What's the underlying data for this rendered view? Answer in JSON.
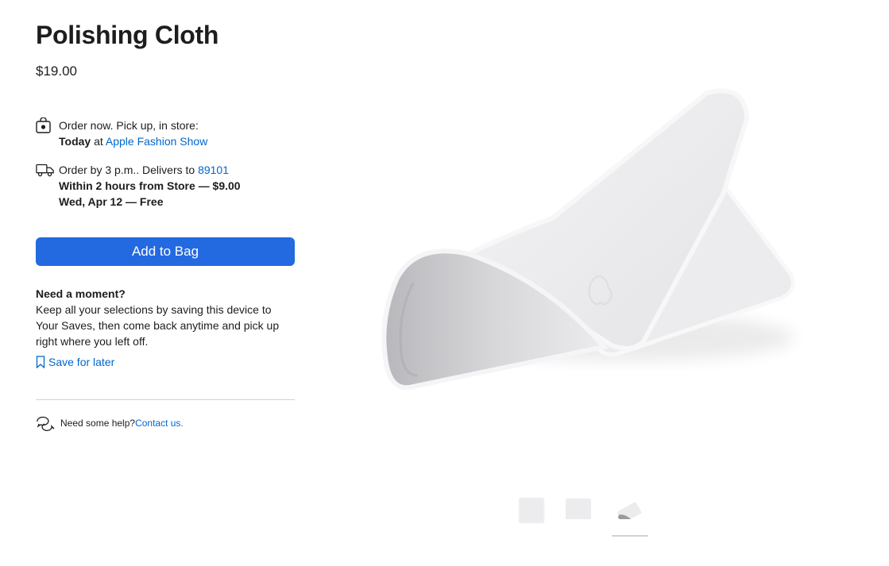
{
  "product": {
    "title": "Polishing Cloth",
    "price": "$19.00"
  },
  "pickup": {
    "icon": "shopping-bag-icon",
    "line1": "Order now. Pick up, in store:",
    "when": "Today",
    "at": " at ",
    "store": "Apple Fashion Show"
  },
  "delivery": {
    "icon": "delivery-truck-icon",
    "line1": "Order by 3 p.m.. Delivers to ",
    "zip": "89101",
    "option1": "Within 2 hours from Store — $9.00",
    "option2": "Wed, Apr 12 — Free"
  },
  "add_to_bag_label": "Add to Bag",
  "moment": {
    "heading": "Need a moment?",
    "body": "Keep all your selections by saving this device to Your Saves, then come back anytime and pick up right where you left off."
  },
  "save_label": "Save for later",
  "help": {
    "icon": "chat-bubbles-icon",
    "text": "Need some help? ",
    "link": "Contact us."
  },
  "gallery": {
    "thumbnails": [
      "thumb-cloth-front",
      "thumb-cloth-flat",
      "thumb-cloth-folded"
    ],
    "selected_index": 2
  },
  "colors": {
    "accent": "#0066cc",
    "button": "#2369e0"
  }
}
